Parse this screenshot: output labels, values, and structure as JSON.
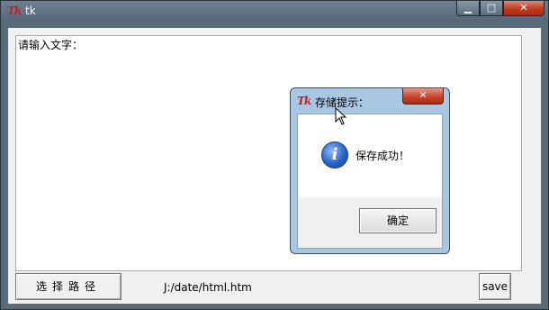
{
  "window": {
    "title": "tk",
    "logo_text": "Tk",
    "controls": {
      "minimize": "▁",
      "maximize": "□",
      "close": "✕"
    }
  },
  "main": {
    "textarea_text": "请输入文字：",
    "path_button_label": "选择路径",
    "path_value": "J:/date/html.htm",
    "save_label": "save"
  },
  "dialog": {
    "title": "存储提示：",
    "logo_text": "Tk",
    "close_label": "✕",
    "icon": "info-icon",
    "message": "保存成功！",
    "ok_label": "确定"
  }
}
